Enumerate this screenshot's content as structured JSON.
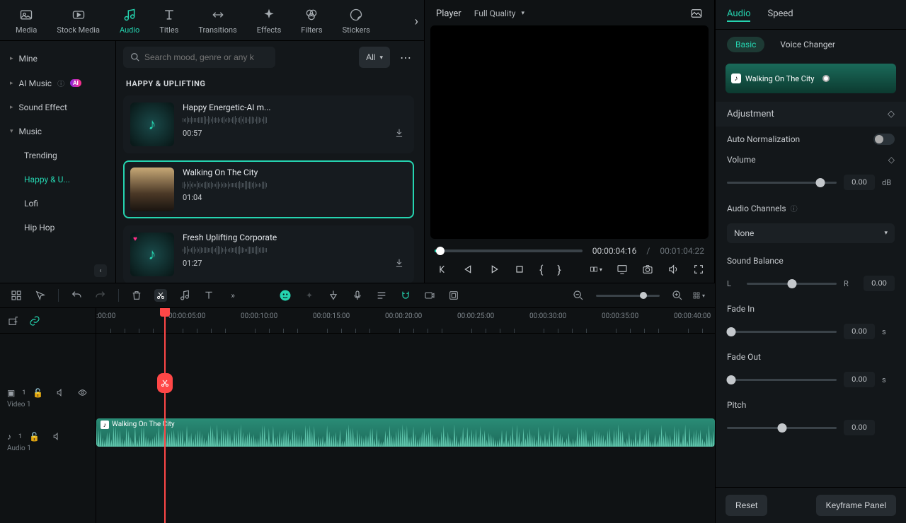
{
  "topTabs": [
    {
      "id": "media",
      "label": "Media"
    },
    {
      "id": "stock",
      "label": "Stock Media"
    },
    {
      "id": "audio",
      "label": "Audio",
      "active": true
    },
    {
      "id": "titles",
      "label": "Titles"
    },
    {
      "id": "transitions",
      "label": "Transitions"
    },
    {
      "id": "effects",
      "label": "Effects"
    },
    {
      "id": "filters",
      "label": "Filters"
    },
    {
      "id": "stickers",
      "label": "Stickers"
    }
  ],
  "sideNav": {
    "items": [
      {
        "id": "mine",
        "label": "Mine",
        "expand": true
      },
      {
        "id": "ai",
        "label": "AI Music",
        "expand": true,
        "ai": true
      },
      {
        "id": "sfx",
        "label": "Sound Effect",
        "expand": true
      },
      {
        "id": "music",
        "label": "Music",
        "expand": true,
        "expanded": true
      }
    ],
    "musicSubs": [
      {
        "id": "trending",
        "label": "Trending"
      },
      {
        "id": "happy",
        "label": "Happy & U...",
        "active": true
      },
      {
        "id": "lofi",
        "label": "Lofi"
      },
      {
        "id": "hiphop",
        "label": "Hip Hop"
      }
    ]
  },
  "search": {
    "placeholder": "Search mood, genre or any keyword",
    "allLabel": "All"
  },
  "categoryHeader": "HAPPY & UPLIFTING",
  "tracks": [
    {
      "title": "Happy Energetic-AI m...",
      "duration": "00:57",
      "thumb": "music",
      "dl": true
    },
    {
      "title": "Walking On The City",
      "duration": "01:04",
      "thumb": "photo",
      "selected": true
    },
    {
      "title": "Fresh Uplifting Corporate",
      "duration": "01:27",
      "thumb": "music",
      "dl": true,
      "heart": true
    }
  ],
  "player": {
    "title": "Player",
    "quality": "Full Quality",
    "currentTime": "00:00:04:16",
    "separator": "/",
    "totalTime": "00:01:04:22"
  },
  "propTabs": {
    "audio": "Audio",
    "speed": "Speed"
  },
  "subTabs": {
    "basic": "Basic",
    "voice": "Voice Changer"
  },
  "clipName": "Walking On The City",
  "adjHeader": "Adjustment",
  "props": {
    "autoNorm": {
      "label": "Auto Normalization"
    },
    "volume": {
      "label": "Volume",
      "value": "0.00",
      "unit": "dB",
      "thumb": 85
    },
    "channels": {
      "label": "Audio Channels",
      "value": "None"
    },
    "balance": {
      "label": "Sound Balance",
      "L": "L",
      "R": "R",
      "value": "0.00",
      "thumb": 50
    },
    "fadeIn": {
      "label": "Fade In",
      "value": "0.00",
      "unit": "s",
      "thumb": 4
    },
    "fadeOut": {
      "label": "Fade Out",
      "value": "0.00",
      "unit": "s",
      "thumb": 4
    },
    "pitch": {
      "label": "Pitch",
      "value": "0.00",
      "thumb": 50
    }
  },
  "footer": {
    "reset": "Reset",
    "keyframe": "Keyframe Panel"
  },
  "timeline": {
    "ticks": [
      ":00:00",
      "00:00:05:00",
      "00:00:10:00",
      "00:00:15:00",
      "00:00:20:00",
      "00:00:25:00",
      "00:00:30:00",
      "00:00:35:00",
      "00:00:40:00"
    ],
    "playheadPx": 96,
    "tracks": [
      {
        "type": "video",
        "name": "Video 1"
      },
      {
        "type": "audio",
        "name": "Audio 1",
        "clip": "Walking On The City"
      }
    ]
  }
}
